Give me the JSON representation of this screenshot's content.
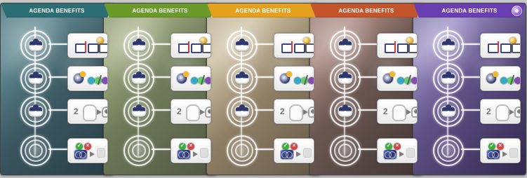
{
  "cards": [
    {
      "title": "AGENDA BENEFITS",
      "theme": {
        "banner": "#2b6f74",
        "tint": "#3d6d73",
        "accent": "#5ea8b0"
      },
      "rows": [
        {
          "node": "agenda-token-icon",
          "reward": "card-slot-reward",
          "reward_text": ""
        },
        {
          "node": "agenda-token-icon",
          "reward": "resource-conversion-reward",
          "reward_text": ""
        },
        {
          "node": "agenda-token-icon",
          "reward": "upgrade-track-reward",
          "reward_text": "2"
        },
        {
          "node": "empty-node-icon",
          "reward": "mission-check-reward",
          "reward_text": ""
        }
      ]
    },
    {
      "title": "AGENDA BENEFITS",
      "theme": {
        "banner": "#6b9a2b",
        "tint": "#72854c",
        "accent": "#9ab95d"
      },
      "rows": [
        {
          "node": "agenda-token-icon",
          "reward": "card-slot-reward",
          "reward_text": ""
        },
        {
          "node": "agenda-token-icon",
          "reward": "resource-conversion-reward",
          "reward_text": ""
        },
        {
          "node": "agenda-token-icon",
          "reward": "upgrade-track-reward",
          "reward_text": "2"
        },
        {
          "node": "empty-node-icon",
          "reward": "mission-check-reward",
          "reward_text": ""
        }
      ]
    },
    {
      "title": "AGENDA BENEFITS",
      "theme": {
        "banner": "#e5a11d",
        "tint": "#9a8562",
        "accent": "#d9bb6c"
      },
      "rows": [
        {
          "node": "agenda-token-icon",
          "reward": "card-slot-reward",
          "reward_text": ""
        },
        {
          "node": "agenda-token-icon",
          "reward": "resource-conversion-reward",
          "reward_text": ""
        },
        {
          "node": "agenda-token-icon",
          "reward": "upgrade-track-reward",
          "reward_text": "2"
        },
        {
          "node": "empty-node-icon",
          "reward": "mission-check-reward",
          "reward_text": ""
        }
      ]
    },
    {
      "title": "AGENDA BENEFITS",
      "theme": {
        "banner": "#c4542c",
        "tint": "#7b5b52",
        "accent": "#b98168"
      },
      "rows": [
        {
          "node": "agenda-token-icon",
          "reward": "card-slot-reward",
          "reward_text": ""
        },
        {
          "node": "agenda-token-icon",
          "reward": "resource-conversion-reward",
          "reward_text": ""
        },
        {
          "node": "agenda-token-icon",
          "reward": "upgrade-track-reward",
          "reward_text": "2"
        },
        {
          "node": "empty-node-icon",
          "reward": "mission-check-reward",
          "reward_text": ""
        }
      ]
    },
    {
      "title": "AGENDA BENEFITS",
      "theme": {
        "banner": "#6a3fb1",
        "tint": "#5d4a86",
        "accent": "#9d83d0"
      },
      "corner_badge": "purple-faction-icon",
      "rows": [
        {
          "node": "agenda-token-icon",
          "reward": "card-slot-reward",
          "reward_text": ""
        },
        {
          "node": "agenda-token-icon",
          "reward": "resource-conversion-reward",
          "reward_text": ""
        },
        {
          "node": "agenda-token-icon",
          "reward": "upgrade-track-reward",
          "reward_text": "2"
        },
        {
          "node": "empty-node-icon",
          "reward": "mission-check-reward",
          "reward_text": ""
        }
      ]
    }
  ]
}
